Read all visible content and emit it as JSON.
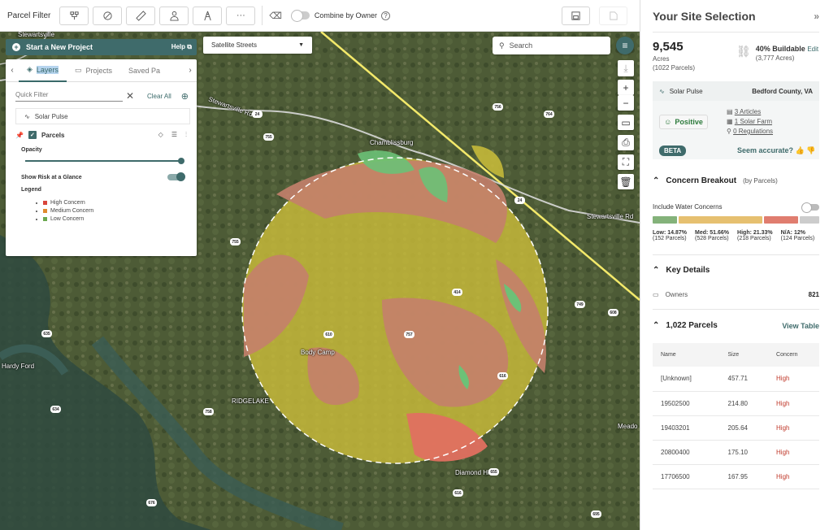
{
  "toolbar": {
    "title": "Parcel Filter",
    "combine_label": "Combine by Owner",
    "help_glyph": "?"
  },
  "map": {
    "start_project": "Start a New Project",
    "help": "Help",
    "basemap": "Satellite Streets",
    "search_placeholder": "Search",
    "labels": {
      "stewartsville": "Stewartsville",
      "stewartsville_rd": "Stewartsville Rd",
      "stewartsville_rd2": "Stewartsville Rd",
      "chamblissburg": "Chamblissburg",
      "body_camp": "Body Camp",
      "ridgelake": "RIDGELAKE",
      "diamond_hill": "Diamond Hill",
      "hardy_ford": "Hardy Ford",
      "meadow": "Meado"
    },
    "shields": [
      "24",
      "24",
      "755",
      "756",
      "764",
      "755",
      "24",
      "735",
      "749",
      "608",
      "635",
      "634",
      "758",
      "757",
      "616",
      "610",
      "655",
      "616",
      "676",
      "695",
      "414",
      "757"
    ]
  },
  "layers": {
    "tabs": [
      "Layers",
      "Projects",
      "Saved Pa"
    ],
    "quick_filter": "Quick Filter",
    "clear_all": "Clear All",
    "solar_pulse": "Solar Pulse",
    "parcels": "Parcels",
    "opacity": "Opacity",
    "risk": "Show Risk at a Glance",
    "legend_title": "Legend",
    "legend": [
      {
        "label": "High Concern",
        "color": "#d9453b"
      },
      {
        "label": "Medium Concern",
        "color": "#e08a2e"
      },
      {
        "label": "Low Concern",
        "color": "#6aa84f"
      }
    ]
  },
  "side": {
    "title": "Your Site Selection",
    "acres_value": "9,545",
    "acres_label": "Acres",
    "acres_parcels": "(1022 Parcels)",
    "buildable": "40% Buildable",
    "buildable_edit": "Edit",
    "buildable_acres": "(3,777 Acres)",
    "solar_pulse": "Solar Pulse",
    "location": "Bedford County, VA",
    "sentiment": "Positive",
    "articles": "3 Articles",
    "solar_farm": "1 Solar Farm",
    "regulations": "0 Regulations",
    "beta": "BETA",
    "accurate": "Seem accurate?",
    "concern_title": "Concern Breakout",
    "concern_sub": "(by Parcels)",
    "water": "Include Water Concerns",
    "concern_low": "Low: 14.87%",
    "concern_low_p": "(152 Parcels)",
    "concern_med": "Med: 51.66%",
    "concern_med_p": "(528 Parcels)",
    "concern_high": "High: 21.33%",
    "concern_high_p": "(218 Parcels)",
    "concern_na": "N/A: 12%",
    "concern_na_p": "(124 Parcels)",
    "concern_shares": [
      {
        "name": "Low",
        "value": 14.87,
        "color": "#84b27a"
      },
      {
        "name": "Med",
        "value": 51.66,
        "color": "#e6c070"
      },
      {
        "name": "High",
        "value": 21.33,
        "color": "#e07d6f"
      },
      {
        "name": "N/A",
        "value": 12,
        "color": "#cccccc"
      }
    ],
    "key_details": "Key Details",
    "owners_label": "Owners",
    "owners_value": "821",
    "parcels_title": "1,022 Parcels",
    "view_table": "View Table",
    "table_headers": [
      "Name",
      "Size",
      "Concern"
    ],
    "table_rows": [
      [
        "[Unknown]",
        "457.71",
        "High"
      ],
      [
        "19502500",
        "214.80",
        "High"
      ],
      [
        "19403201",
        "205.64",
        "High"
      ],
      [
        "20800400",
        "175.10",
        "High"
      ],
      [
        "17706500",
        "167.95",
        "High"
      ]
    ]
  }
}
